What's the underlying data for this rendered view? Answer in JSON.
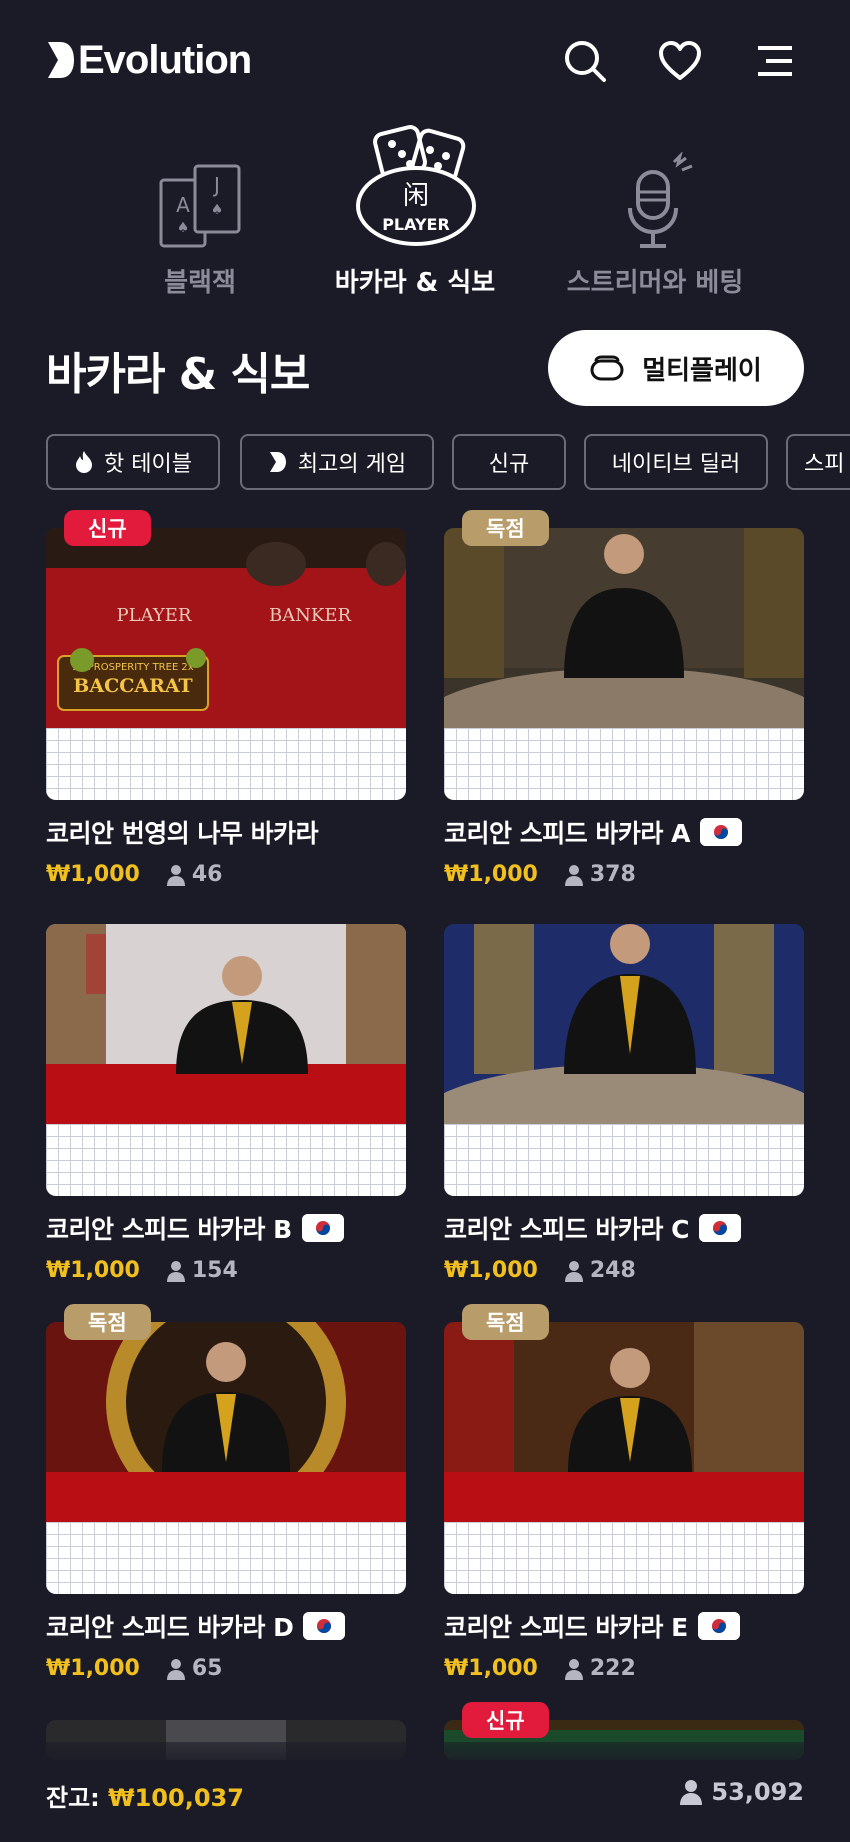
{
  "header": {
    "logo_text": "Evolution",
    "icons": [
      "search-icon",
      "heart-icon",
      "menu-icon"
    ]
  },
  "categories": [
    {
      "label": "블랙잭",
      "icon": "cards-icon",
      "active": false
    },
    {
      "label": "바카라 & 식보",
      "icon": "dice-player-icon",
      "active": true
    },
    {
      "label": "스트리머와 베팅",
      "icon": "microphone-icon",
      "active": false
    }
  ],
  "section": {
    "title": "바카라 & 식보",
    "multiplay_label": "멀티플레이"
  },
  "chips": [
    {
      "label": "핫 테이블",
      "icon": "flame-icon"
    },
    {
      "label": "최고의 게임",
      "icon": "evolution-mark-icon"
    },
    {
      "label": "신규",
      "icon": ""
    },
    {
      "label": "네이티브 딜러",
      "icon": ""
    },
    {
      "label": "스피",
      "icon": ""
    }
  ],
  "games": [
    {
      "title": "코리안 번영의 나무 바카라",
      "badge": "신규",
      "flag": false,
      "bet": "₩1,000",
      "players": "46",
      "scene_text": [
        "PLAYER",
        "BANKER"
      ],
      "logo_text": "3x PROSPERITY TREE 2x BACCARAT Live"
    },
    {
      "title": "코리안 스피드 바카라 A",
      "badge": "독점",
      "flag": true,
      "bet": "₩1,000",
      "players": "378"
    },
    {
      "title": "코리안 스피드 바카라 B",
      "badge": "",
      "flag": true,
      "bet": "₩1,000",
      "players": "154"
    },
    {
      "title": "코리안 스피드 바카라 C",
      "badge": "",
      "flag": true,
      "bet": "₩1,000",
      "players": "248"
    },
    {
      "title": "코리안 스피드 바카라 D",
      "badge": "독점",
      "flag": true,
      "bet": "₩1,000",
      "players": "65"
    },
    {
      "title": "코리안 스피드 바카라 E",
      "badge": "독점",
      "flag": true,
      "bet": "₩1,000",
      "players": "222"
    },
    {
      "title": "",
      "badge": "",
      "flag": false,
      "bet": "",
      "players": ""
    },
    {
      "title": "",
      "badge": "신규",
      "flag": false,
      "bet": "",
      "players": ""
    }
  ],
  "footer": {
    "balance_label": "잔고: ",
    "balance_value": "₩100,037",
    "online_count": "53,092"
  },
  "colors": {
    "background": "#1b1b27",
    "gold": "#f2c01e",
    "badge_new": "#e21b3c",
    "badge_exclusive": "#b89d6b"
  }
}
